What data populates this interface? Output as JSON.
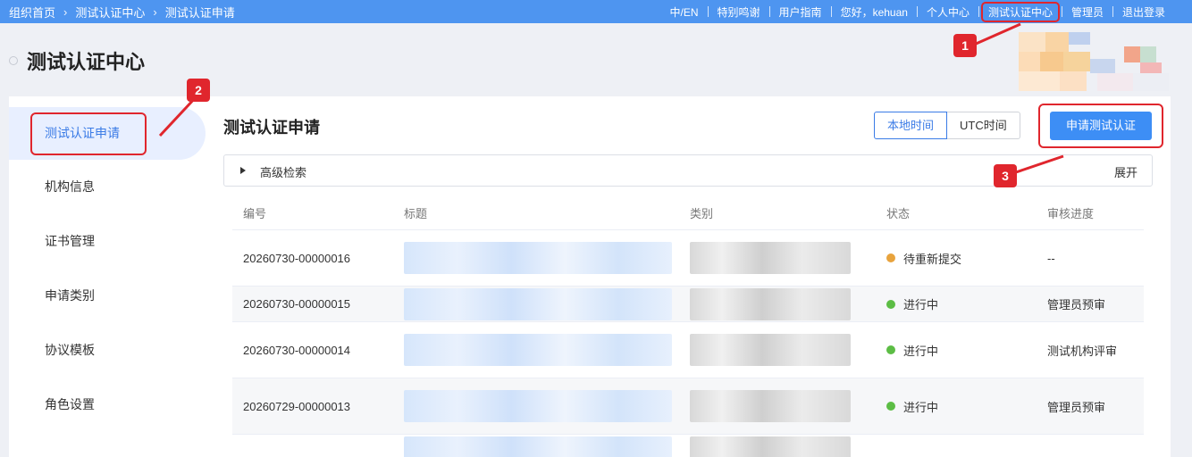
{
  "breadcrumb": [
    "组织首页",
    "测试认证中心",
    "测试认证申请"
  ],
  "top_nav": [
    "中/EN",
    "特别鸣谢",
    "用户指南",
    "您好，kehuan",
    "个人中心",
    "测试认证中心",
    "管理员",
    "退出登录"
  ],
  "page_title": "测试认证中心",
  "sidebar": {
    "items": [
      {
        "label": "测试认证申请",
        "active": true
      },
      {
        "label": "机构信息"
      },
      {
        "label": "证书管理"
      },
      {
        "label": "申请类别"
      },
      {
        "label": "协议模板"
      },
      {
        "label": "角色设置"
      }
    ]
  },
  "content": {
    "title": "测试认证申请",
    "time_toggle": {
      "local": "本地时间",
      "utc": "UTC时间"
    },
    "apply_button": "申请测试认证",
    "advanced_search": "高级检索",
    "expand": "展开"
  },
  "table": {
    "headers": [
      "编号",
      "标题",
      "类别",
      "状态",
      "审核进度"
    ],
    "rows": [
      {
        "id": "20260730-00000016",
        "status": "待重新提交",
        "status_color": "#e8a33d",
        "progress": "--"
      },
      {
        "id": "20260730-00000015",
        "status": "进行中",
        "status_color": "#5cbd45",
        "progress": "管理员预审"
      },
      {
        "id": "20260730-00000014",
        "status": "进行中",
        "status_color": "#5cbd45",
        "progress": "测试机构评审"
      },
      {
        "id": "20260729-00000013",
        "status": "进行中",
        "status_color": "#5cbd45",
        "progress": "管理员预审"
      }
    ]
  },
  "annotations": [
    "1",
    "2",
    "3"
  ],
  "colors": {
    "topbar": "#4e95f0",
    "primary": "#3d8ef5",
    "highlight": "#e0262d"
  }
}
